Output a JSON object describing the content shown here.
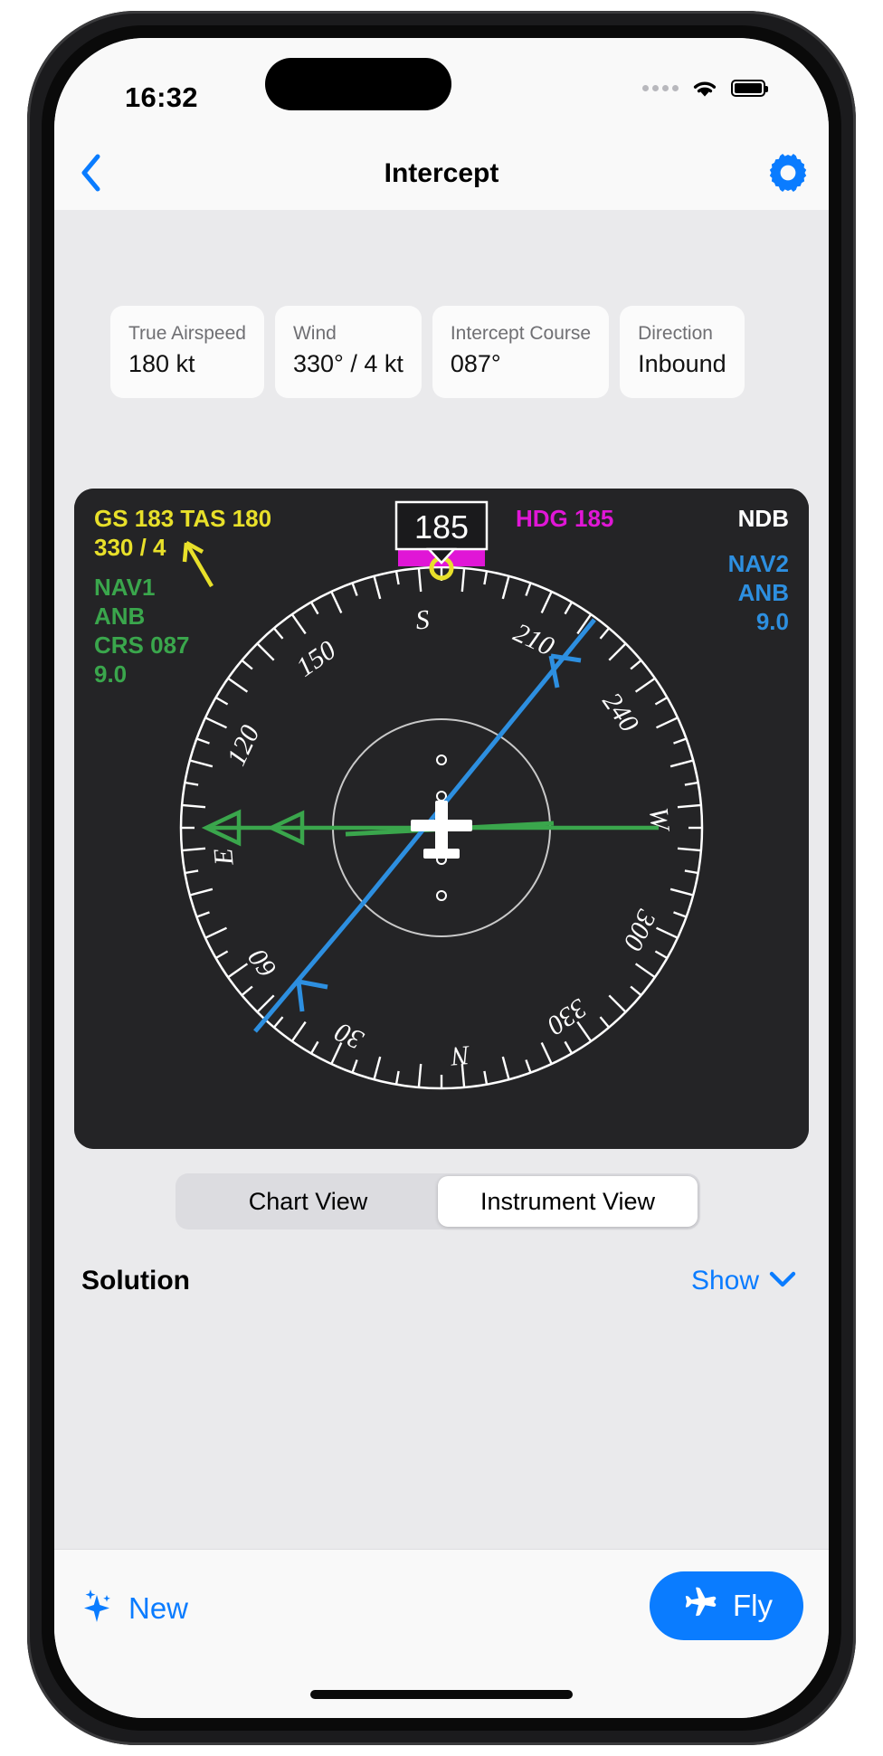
{
  "status_bar": {
    "time": "16:32",
    "cellular_icon": "signal-dots-icon",
    "wifi_icon": "wifi-icon",
    "battery_icon": "battery-full-icon"
  },
  "nav_bar": {
    "back_icon": "chevron-left-icon",
    "title": "Intercept",
    "settings_icon": "gear-icon"
  },
  "params": [
    {
      "label": "True Airspeed",
      "value": "180 kt"
    },
    {
      "label": "Wind",
      "value": "330° / 4 kt"
    },
    {
      "label": "Intercept Course",
      "value": "087°"
    },
    {
      "label": "Direction",
      "value": "Inbound"
    }
  ],
  "instrument": {
    "type": "hsi-rmi-compass",
    "mode_label": "NDB",
    "wind_line1": "GS 183 TAS 180",
    "wind_line2": "330 / 4",
    "heading_label": "HDG 185",
    "heading_box_value": "185",
    "nav1": {
      "title": "NAV1",
      "ident": "ANB",
      "course": "CRS 087",
      "distance": "9.0"
    },
    "nav2": {
      "title": "NAV2",
      "ident": "ANB",
      "distance": "9.0"
    },
    "compass_ticks": [
      "N",
      "30",
      "60",
      "E",
      "120",
      "150",
      "S",
      "210",
      "240",
      "W",
      "300",
      "330"
    ],
    "aircraft_heading_deg": 185,
    "heading_bug_deg": 185,
    "nav1_course_deg": 87,
    "colors": {
      "background": "#242426",
      "wind_text": "#e8e02a",
      "nav1_text": "#3aa64c",
      "nav2_text": "#2d8fe0",
      "heading_text": "#e016d6",
      "mode_text": "#ffffff",
      "compass": "#ffffff",
      "heading_bug": "#e016d6",
      "bug_marker": "#e8e02a"
    }
  },
  "view_switch": {
    "options": [
      {
        "label": "Chart View",
        "active": false
      },
      {
        "label": "Instrument View",
        "active": true
      }
    ]
  },
  "solution": {
    "title": "Solution",
    "toggle_label": "Show",
    "toggle_icon": "chevron-down-icon"
  },
  "toolbar": {
    "new_label": "New",
    "new_icon": "sparkles-icon",
    "fly_label": "Fly",
    "fly_icon": "airplane-icon",
    "fly_color": "#0a7cff"
  }
}
